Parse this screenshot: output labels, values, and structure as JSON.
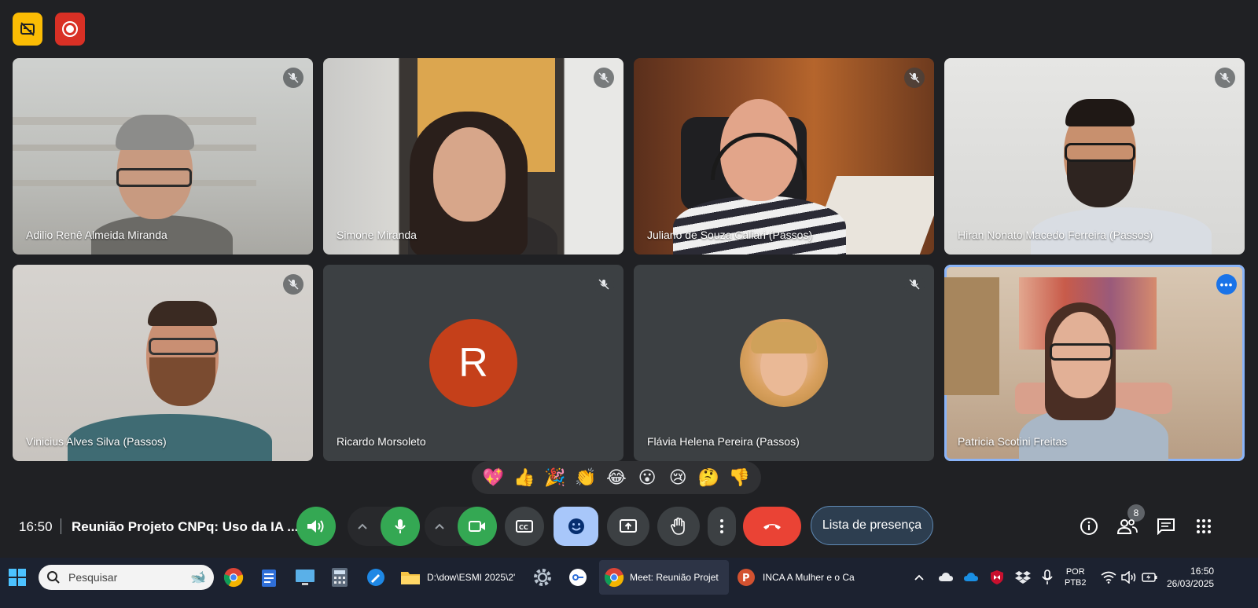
{
  "participants": [
    {
      "name": "Adilio Renê Almeida Miranda"
    },
    {
      "name": "Simone Miranda"
    },
    {
      "name": "Juliano de Souza Caliari (Passos)"
    },
    {
      "name": "Hiran Nonato Macedo Ferreira (Passos)"
    },
    {
      "name": "Vinicius Alves Silva (Passos)"
    },
    {
      "name": "Ricardo Morsoleto",
      "initial": "R"
    },
    {
      "name": "Flávia Helena Pereira (Passos)"
    },
    {
      "name": "Patricia Scotini Freitas"
    }
  ],
  "reactions": [
    "💖",
    "👍",
    "🎉",
    "👏",
    "😂",
    "😮",
    "😢",
    "🤔",
    "👎"
  ],
  "bottom_bar": {
    "clock": "16:50",
    "meeting_title": "Reunião Projeto CNPq: Uso da IA ...",
    "attendance_label": "Lista de presença",
    "participant_count": "8"
  },
  "taskbar": {
    "search_placeholder": "Pesquisar",
    "explorer_label": "D:\\dow\\ESMI 2025\\2'",
    "chrome_window_label": "Meet: Reunião Projet",
    "ppt_window_label": "INCA A Mulher e o Ca",
    "language_top": "POR",
    "language_bottom": "PTB2",
    "time": "16:50",
    "date": "26/03/2025"
  },
  "colors": {
    "background": "#202124",
    "accent_green": "#34a853",
    "end_call_red": "#ea4335",
    "active_tile_outline": "#8ab4f8",
    "avatar_ricardo": "#c5401a"
  }
}
